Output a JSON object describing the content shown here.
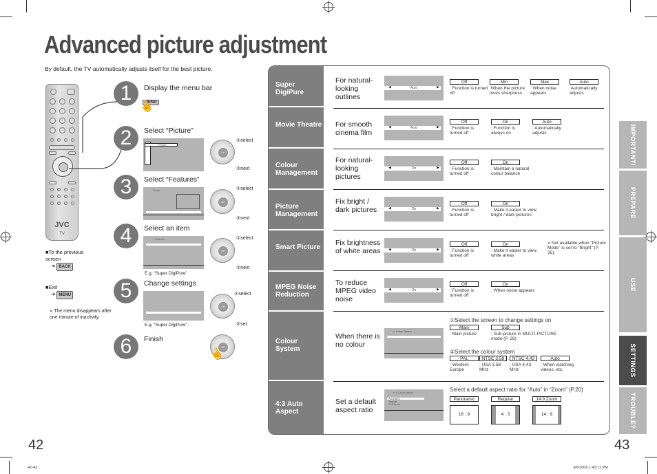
{
  "page": {
    "title": "Advanced picture adjustment",
    "intro": "By default, the TV automatically adjusts itself for the best picture.",
    "page_left": "42",
    "page_right": "43",
    "footer_left": "42-43",
    "footer_right": "3/6/2006   1:43:11 PM"
  },
  "remote": {
    "brand": "JVC",
    "model_label": "TV"
  },
  "side_notes": {
    "previous_heading": "To the previous screen",
    "previous_key": "BACK",
    "exit_heading": "Exit",
    "exit_key": "MENU",
    "inactivity_note": "The menu disappears after one minute of inactivity."
  },
  "steps": [
    {
      "num": "1",
      "label": "Display the menu bar",
      "key": "MENU"
    },
    {
      "num": "2",
      "label": "Select “Picture”",
      "osd_item": "Picture",
      "nav1": "①select",
      "nav2": "②next"
    },
    {
      "num": "3",
      "label": "Select “Features”",
      "osd_title": "Picture",
      "nav1": "①select",
      "nav2": "②next"
    },
    {
      "num": "4",
      "label": "Select an item",
      "osd_title": "> Features",
      "caption": "E.g. “Super DigiPure”",
      "nav1": "①select",
      "nav2": "②next"
    },
    {
      "num": "5",
      "label": "Change settings",
      "caption": "E.g. “Super DigiPure”",
      "nav1": "①select",
      "nav2": "②set"
    },
    {
      "num": "6",
      "label": "Finish"
    }
  ],
  "features": [
    {
      "name": "Super DigiPure",
      "desc": "For natural-looking outlines",
      "screen_value": "Auto",
      "options": [
        {
          "label": "Off",
          "desc": ": Function is turned off"
        },
        {
          "label": "Min",
          "desc": ":When the picture loses sharpness"
        },
        {
          "label": "Max",
          "desc": ": When noise appears"
        },
        {
          "label": "Auto",
          "desc": ":Automatically adjusts"
        }
      ]
    },
    {
      "name": "Movie Theatre",
      "desc": "For smooth cinema film",
      "screen_value": "Auto",
      "options": [
        {
          "label": "Off",
          "desc": ": Function is turned off"
        },
        {
          "label": "On",
          "desc": ": Function is always on"
        },
        {
          "label": "Auto",
          "desc": ": Automatically adjusts"
        }
      ]
    },
    {
      "name": "Colour Management",
      "desc": "For natural-looking pictures",
      "screen_value": "On",
      "options": [
        {
          "label": "Off",
          "desc": ": Function is turned off"
        },
        {
          "label": "On",
          "desc": ": Maintain a natural colour balance"
        }
      ]
    },
    {
      "name": "Picture Management",
      "desc": "Fix bright / dark pictures",
      "screen_value": "On",
      "options": [
        {
          "label": "Off",
          "desc": ": Function is turned off"
        },
        {
          "label": "On",
          "desc": ": Make it easier to view bright / dark pictures"
        }
      ]
    },
    {
      "name": "Smart Picture",
      "desc": "Fix brightness of white areas",
      "screen_value": "On",
      "options": [
        {
          "label": "Off",
          "desc": ": Function is turned off"
        },
        {
          "label": "On",
          "desc": ": Make it easier to view white areas"
        }
      ],
      "note": "Not available when “Picture Mode” is set to “Bright” (P. 35)."
    },
    {
      "name": "MPEG Noise Reduction",
      "desc": "To reduce MPEG video noise",
      "screen_value": "On",
      "options": [
        {
          "label": "Off",
          "desc": ": Function is turned off"
        },
        {
          "label": "On",
          "desc": ": When noise appears"
        }
      ]
    },
    {
      "name": "Colour System",
      "desc": "When there is no colour",
      "screen_title": ">> Colour System",
      "step1": "①Select the screen to change settings on",
      "screens": [
        {
          "label": "Main",
          "desc": ": Main picture"
        },
        {
          "label": "Sub",
          "desc": ": Sub-picture in MULTI-PICTURE mode (P. 28)"
        }
      ],
      "step2": "②Select the colour system",
      "options": [
        {
          "label": "PAL",
          "desc": ": Western Europe"
        },
        {
          "label": "NTSC 3.58",
          "desc": ": USA 3.58 MHz"
        },
        {
          "label": "NTSC 4.43",
          "desc": ": USA 4.43 MHz"
        },
        {
          "label": "Auto",
          "desc": ": When watching videos, etc."
        }
      ]
    },
    {
      "name": "4:3 Auto Aspect",
      "desc": "Set a default aspect ratio",
      "screen_title": ">> 4:3 Auto Aspect",
      "screen_items": [
        "Panoramic",
        "Regular",
        "14:9 Zoom"
      ],
      "instruction": "Select a default aspect ratio for “Auto” in “Zoom” (P.20)",
      "options": [
        {
          "label": "Panoramic",
          "ratio": "16 : 9"
        },
        {
          "label": "Regular",
          "ratio": "4 : 3"
        },
        {
          "label": "14:9 Zoom",
          "ratio": "14 : 9"
        }
      ]
    }
  ],
  "tabs": [
    {
      "label": "IMPORTANT!",
      "active": false
    },
    {
      "label": "PREPARE",
      "active": false
    },
    {
      "label": "USE",
      "active": false
    },
    {
      "label": "SETTINGS",
      "active": true
    },
    {
      "label": "TROUBLE?",
      "active": false
    }
  ]
}
